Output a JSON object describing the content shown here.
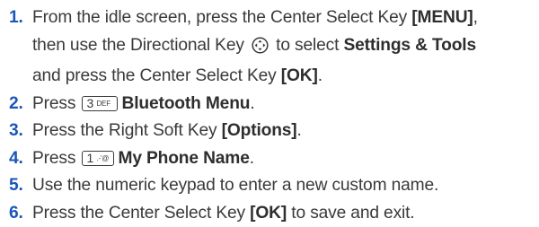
{
  "steps": [
    {
      "num": "1.",
      "lines": [
        {
          "a": "From the idle screen, press the Center Select Key ",
          "b": "[MENU]",
          "c": ","
        },
        {
          "a": "then use the Directional Key ",
          "icon": "directional-key-icon",
          "b": " to select ",
          "bold": "Settings & Tools"
        },
        {
          "a": "and press the Center Select Key ",
          "b": "[OK]",
          "c": "."
        }
      ]
    },
    {
      "num": "2.",
      "a": "Press ",
      "key": {
        "main": "3",
        "sub": "DEF"
      },
      "bold": "Bluetooth Menu",
      "c": "."
    },
    {
      "num": "3.",
      "a": "Press the Right Soft Key ",
      "bold": "[Options]",
      "c": "."
    },
    {
      "num": "4.",
      "a": "Press ",
      "key": {
        "main": "1",
        "sub": ".-'@"
      },
      "bold": "My Phone Name",
      "c": "."
    },
    {
      "num": "5.",
      "a": "Use the numeric keypad to enter a new custom name."
    },
    {
      "num": "6.",
      "a": "Press the Center Select Key ",
      "bold": "[OK]",
      "c": " to save and exit."
    }
  ],
  "colors": {
    "step_number": "#1a56b8",
    "text": "#3a3a3a"
  }
}
